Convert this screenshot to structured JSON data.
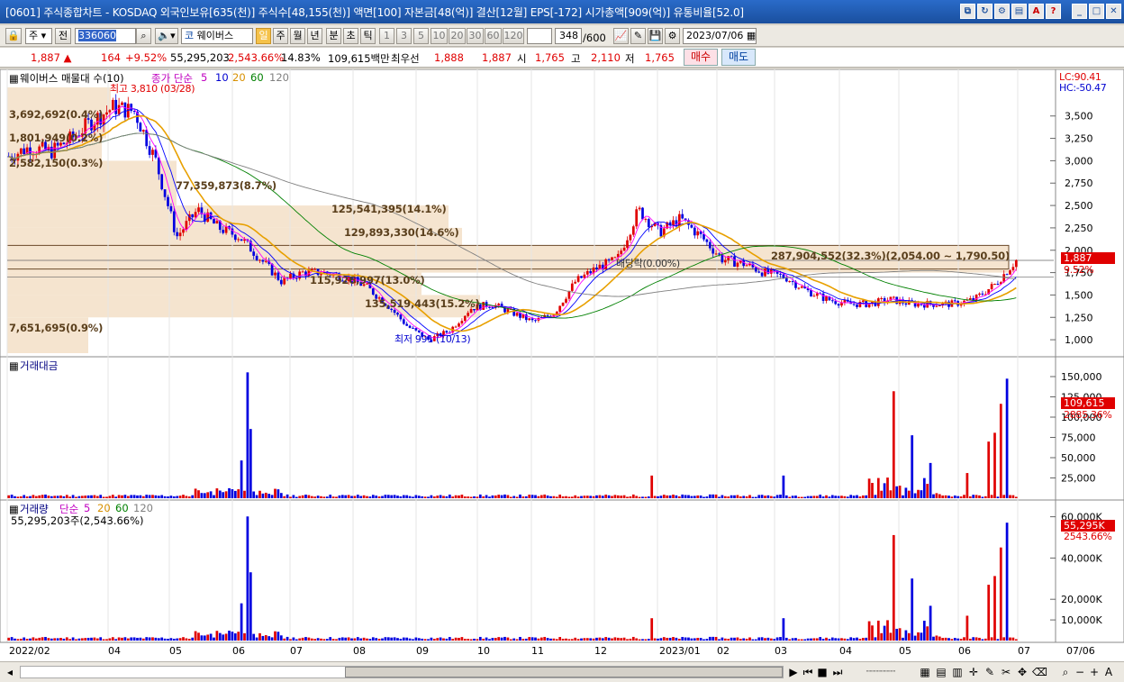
{
  "window": {
    "title": "[0601] 주식종합차트 - KOSDAQ 외국인보유[635(천)] 주식수[48,155(천)] 액면[100] 자본금[48(억)] 결산[12월] EPS[-172] 시가총액[909(억)] 유통비율[52.0]"
  },
  "toolbar": {
    "type_select": "주",
    "prev_label": "전",
    "code": "336060",
    "stock_name": "웨이버스",
    "periods": [
      "일",
      "주",
      "월",
      "년",
      "분",
      "초",
      "틱"
    ],
    "active_period": "일",
    "intervals": [
      "1",
      "3",
      "5",
      "10",
      "20",
      "30",
      "60",
      "120"
    ],
    "count": "348",
    "count_max": "/600",
    "date": "2023/07/06"
  },
  "quote": {
    "price": "1,887",
    "change": "164",
    "change_pct": "+9.52%",
    "volume": "55,295,203",
    "volume_ratio": "2,543.66%",
    "turnover": "14.83%",
    "amount": "109,615백만",
    "best_bid_label": "최우선",
    "best_bid": "1,888",
    "best_ask": "1,887",
    "open_label": "시",
    "open": "1,765",
    "high_label": "고",
    "high": "2,110",
    "low_label": "저",
    "low": "1,765",
    "buy_label": "매수",
    "sell_label": "매도"
  },
  "price_pane": {
    "legend_name": "웨이버스 매물대 수(10)",
    "legend_ma_title": "종가 단순",
    "legend_ma": [
      "5",
      "10",
      "20",
      "60",
      "120"
    ],
    "lc": "LC:90.41",
    "hc": "HC:-50.47",
    "current_price": "1,887",
    "current_pct": "9.52%",
    "high_note": "최고 3,810 (03/28)",
    "low_note": "최저 991 (10/13)",
    "dividend_note": "배당락(0.00%)",
    "vp_labels": [
      "3,692,692(0.4%)",
      "1,801,949(0.2%)",
      "2,582,150(0.3%)",
      "77,359,873(8.7%)",
      "125,541,395(14.1%)",
      "129,893,330(14.6%)",
      "287,904,552(32.3%)(2,054.00 ~ 1,790.50)",
      "115,926,997(13.0%)",
      "135,519,443(15.2%)",
      "7,651,695(0.9%)"
    ]
  },
  "amount_pane": {
    "title": "거래대금",
    "current": "109,615",
    "ratio": "2885.36%"
  },
  "volume_pane": {
    "title": "거래량",
    "legend_ma_title": "단순",
    "legend_ma": [
      "5",
      "20",
      "60",
      "120"
    ],
    "subtitle": "55,295,203주(2,543.66%)",
    "current": "55,295K",
    "ratio": "2543.66%"
  },
  "chart_data": [
    {
      "type": "candlestick",
      "title": "",
      "x_labels": [
        "2022/02",
        "04",
        "05",
        "06",
        "07",
        "08",
        "09",
        "10",
        "11",
        "12",
        "2023/01",
        "02",
        "03",
        "04",
        "05",
        "06",
        "07",
        "07/06"
      ],
      "y_ticks": [
        "3,500",
        "3,250",
        "3,000",
        "2,750",
        "2,500",
        "2,250",
        "2,000",
        "1,750",
        "1,500",
        "1,250",
        "1,000"
      ],
      "ylim": [
        850,
        3900
      ],
      "close_approx": [
        3050,
        3150,
        3100,
        3250,
        3450,
        3600,
        3550,
        3000,
        2150,
        2450,
        2250,
        2150,
        1900,
        1650,
        1750,
        1750,
        1700,
        1600,
        1400,
        1150,
        1000,
        1100,
        1350,
        1400,
        1300,
        1200,
        1300,
        1650,
        1800,
        1900,
        2450,
        2200,
        2350,
        2150,
        1900,
        1850,
        1750,
        1700,
        1550,
        1450,
        1400,
        1400,
        1450,
        1400,
        1400,
        1400,
        1450,
        1620,
        1887
      ],
      "series": [
        {
          "name": "5",
          "color": "#ff00ff"
        },
        {
          "name": "10",
          "color": "#0000ff"
        },
        {
          "name": "20",
          "color": "#e8a000"
        },
        {
          "name": "60",
          "color": "#008000"
        },
        {
          "name": "120",
          "color": "#808080"
        }
      ]
    },
    {
      "type": "bar",
      "title": "거래대금",
      "y_ticks": [
        "150,000",
        "125,000",
        "100,000",
        "75,000",
        "50,000",
        "25,000"
      ],
      "ylim": [
        0,
        160000
      ]
    },
    {
      "type": "bar",
      "title": "거래량",
      "y_ticks": [
        "60,000K",
        "40,000K",
        "20,000K",
        "10,000K"
      ],
      "ylim": [
        0,
        62000000
      ]
    }
  ],
  "bottom": {
    "zoom_minus": "−",
    "zoom_plus": "+",
    "font_label": "A"
  }
}
